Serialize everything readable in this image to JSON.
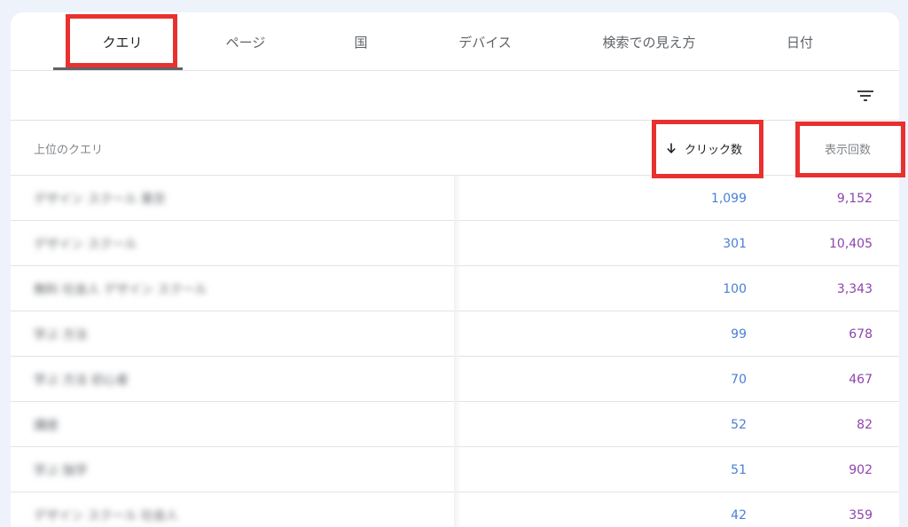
{
  "tabs": [
    {
      "label": "クエリ",
      "active": true
    },
    {
      "label": "ページ",
      "active": false
    },
    {
      "label": "国",
      "active": false
    },
    {
      "label": "デバイス",
      "active": false
    },
    {
      "label": "検索での見え方",
      "active": false
    },
    {
      "label": "日付",
      "active": false
    }
  ],
  "filter": {
    "icon": "filter-icon"
  },
  "table": {
    "headers": {
      "query": "上位のクエリ",
      "clicks": "クリック数",
      "impressions": "表示回数"
    },
    "sort_icon": "arrow-down-icon",
    "rows": [
      {
        "query": "デザイン スクール 東京",
        "clicks": "1,099",
        "impressions": "9,152"
      },
      {
        "query": "デザイン スクール",
        "clicks": "301",
        "impressions": "10,405"
      },
      {
        "query": "無料 社会人 デザイン スクール",
        "clicks": "100",
        "impressions": "3,343"
      },
      {
        "query": "学ぶ 方法",
        "clicks": "99",
        "impressions": "678"
      },
      {
        "query": "学ぶ 方法 初心者",
        "clicks": "70",
        "impressions": "467"
      },
      {
        "query": "講座",
        "clicks": "52",
        "impressions": "82"
      },
      {
        "query": "学ぶ 独学",
        "clicks": "51",
        "impressions": "902"
      },
      {
        "query": "デザイン スクール 社会人",
        "clicks": "42",
        "impressions": "359"
      }
    ]
  },
  "colors": {
    "clicks": "#4a7fd6",
    "impressions": "#8e44ad",
    "highlight": "#e8312f"
  }
}
